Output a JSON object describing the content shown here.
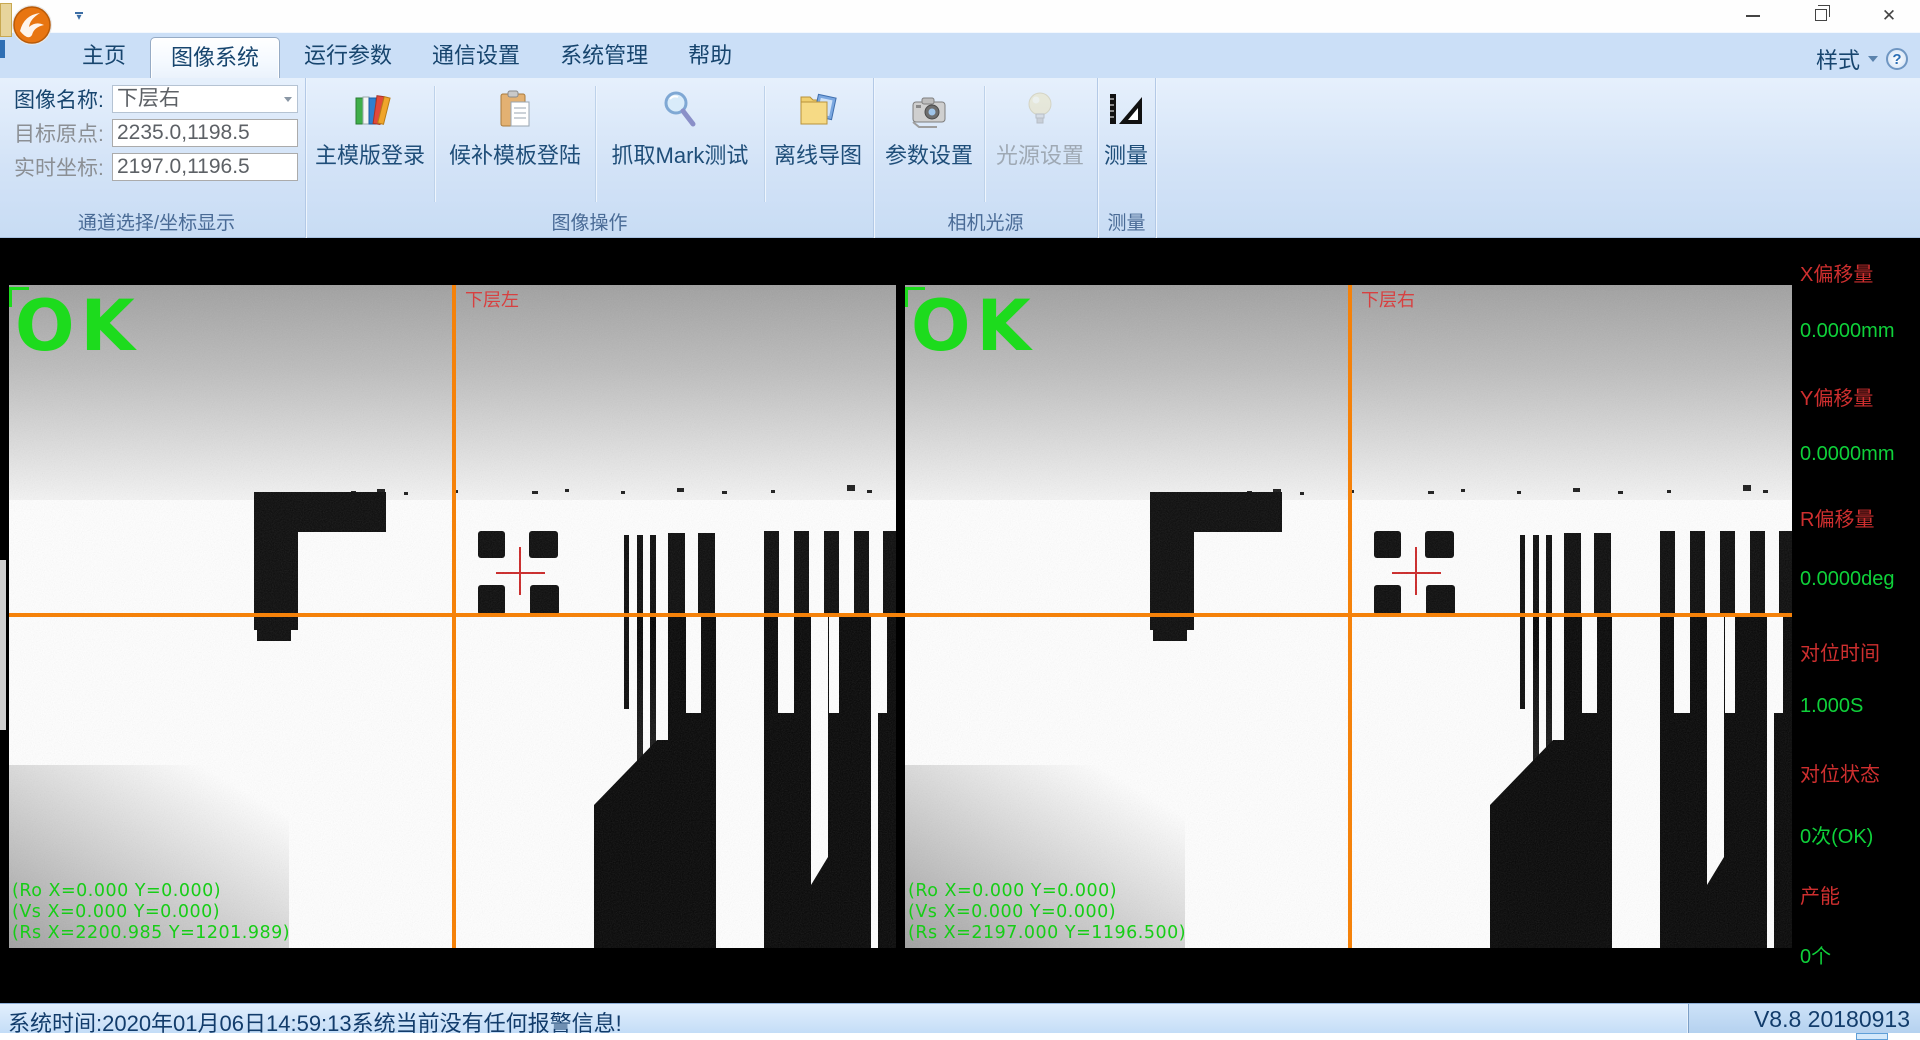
{
  "menu": {
    "tabs": [
      {
        "label": "主页",
        "selected": false
      },
      {
        "label": "图像系统",
        "selected": true
      },
      {
        "label": "运行参数",
        "selected": false
      },
      {
        "label": "通信设置",
        "selected": false
      },
      {
        "label": "系统管理",
        "selected": false
      },
      {
        "label": "帮助",
        "selected": false
      }
    ],
    "style_label": "样式"
  },
  "ribbon": {
    "channel": {
      "caption": "通道选择/坐标显示",
      "rows": [
        {
          "label": "图像名称:",
          "value": "下层右"
        },
        {
          "label": "目标原点:",
          "value": "2235.0,1198.5"
        },
        {
          "label": "实时坐标:",
          "value": "2197.0,1196.5"
        }
      ]
    },
    "image_ops": {
      "caption": "图像操作",
      "buttons": [
        {
          "label": "主模版登录",
          "icon": "books-icon"
        },
        {
          "label": "候补模板登陆",
          "icon": "clipboard-icon"
        },
        {
          "label": "抓取Mark测试",
          "icon": "magnifier-icon"
        },
        {
          "label": "离线导图",
          "icon": "folder-image-icon"
        }
      ]
    },
    "camera": {
      "caption": "相机光源",
      "buttons": [
        {
          "label": "参数设置",
          "icon": "camera-icon",
          "enabled": true
        },
        {
          "label": "光源设置",
          "icon": "bulb-icon",
          "enabled": false
        }
      ]
    },
    "measure": {
      "caption": "测量",
      "buttons": [
        {
          "label": "测量",
          "icon": "set-square-icon"
        }
      ]
    }
  },
  "panels": [
    {
      "result": "OK",
      "name": "下层左",
      "telemetry": [
        "(Ro X=0.000 Y=0.000)",
        "(Vs X=0.000 Y=0.000)",
        "(Rs X=2200.985 Y=1201.989)"
      ]
    },
    {
      "result": "OK",
      "name": "下层右",
      "telemetry": [
        "(Ro X=0.000 Y=0.000)",
        "(Vs X=0.000 Y=0.000)",
        "(Rs X=2197.000 Y=1196.500)"
      ]
    }
  ],
  "info": {
    "items": [
      {
        "label": "X偏移量",
        "value": "0.0000mm"
      },
      {
        "label": "Y偏移量",
        "value": "0.0000mm"
      },
      {
        "label": "R偏移量",
        "value": "0.0000deg"
      },
      {
        "label": "对位时间",
        "value": "1.000S"
      },
      {
        "label": "对位状态",
        "value": "0次(OK)"
      },
      {
        "label": "产能",
        "value": "0个"
      }
    ]
  },
  "status": {
    "message": "系统时间:2020年01月06日14:59:13系统当前没有任何报警信息!",
    "version": "V8.8  20180913"
  },
  "colors": {
    "crosshair_orange": "#f5820a",
    "ok_green": "#1ddb1d",
    "label_red": "#cf2f2f",
    "value_green": "#0fd13a"
  }
}
